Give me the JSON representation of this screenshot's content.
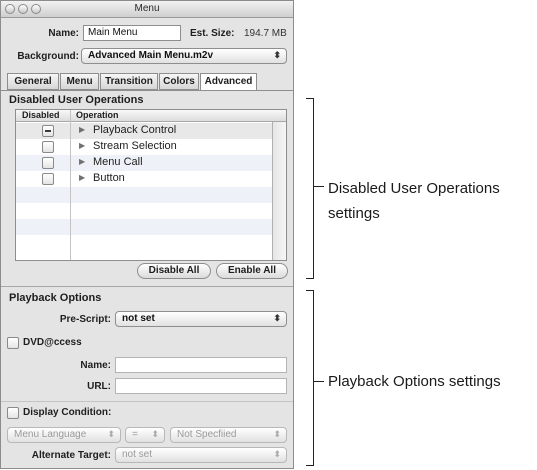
{
  "window": {
    "title": "Menu"
  },
  "header": {
    "name_label": "Name:",
    "name_value": "Main Menu",
    "est_size_label": "Est. Size:",
    "est_size_value": "194.7 MB",
    "background_label": "Background:",
    "background_value": "Advanced Main Menu.m2v"
  },
  "tabs": [
    {
      "label": "General"
    },
    {
      "label": "Menu"
    },
    {
      "label": "Transition"
    },
    {
      "label": "Colors"
    },
    {
      "label": "Advanced",
      "active": true
    }
  ],
  "disabled_ops": {
    "title": "Disabled User Operations",
    "columns": [
      "Disabled",
      "Operation"
    ],
    "rows": [
      {
        "operation": "Playback Control",
        "state": "mixed"
      },
      {
        "operation": "Stream Selection",
        "state": "unchecked"
      },
      {
        "operation": "Menu Call",
        "state": "unchecked"
      },
      {
        "operation": "Button",
        "state": "unchecked"
      }
    ],
    "disable_all_label": "Disable All",
    "enable_all_label": "Enable All"
  },
  "playback": {
    "title": "Playback Options",
    "prescript_label": "Pre-Script:",
    "prescript_value": "not set",
    "dvdaccess_label": "DVD@ccess",
    "name_label": "Name:",
    "name_value": "",
    "url_label": "URL:",
    "url_value": "",
    "display_condition_label": "Display Condition:",
    "condition_source": "Menu Language",
    "condition_operator": "=",
    "condition_value": "Not Specfiied",
    "alternate_target_label": "Alternate Target:",
    "alternate_target_value": "not set"
  },
  "callouts": {
    "disabled_ops_line1": "Disabled User Operations",
    "disabled_ops_line2": "settings",
    "playback": "Playback Options settings"
  }
}
